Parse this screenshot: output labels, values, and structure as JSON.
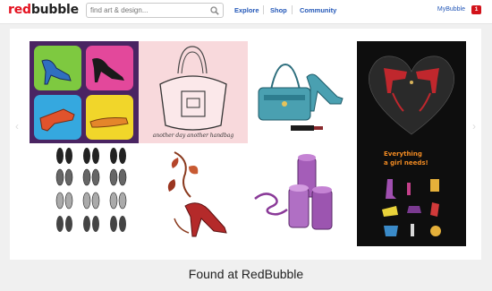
{
  "header": {
    "logo_part1": "red",
    "logo_part2": "bubble",
    "search_placeholder": "find art & design...",
    "nav": [
      "Explore",
      "Shop",
      "Community"
    ],
    "account_label": "MyBubble",
    "notification_count": "1"
  },
  "gallery": {
    "tiles": [
      {
        "name": "shoes-popart",
        "background": "#4a2462"
      },
      {
        "name": "handbag-sketch",
        "background": "#f8d9dc",
        "caption": "another day another handbag"
      },
      {
        "name": "bag-and-heels",
        "background": "#ffffff"
      },
      {
        "name": "heart-heels",
        "background": "#0e0e0e"
      },
      {
        "name": "shoe-grid",
        "background": "#ffffff"
      },
      {
        "name": "floral-heel",
        "background": "#ffffff"
      },
      {
        "name": "lipsticks",
        "background": "#ffffff"
      },
      {
        "name": "girl-needs",
        "background": "#0e0e0e",
        "title_line1": "Everything",
        "title_line2": "a girl needs!"
      }
    ]
  },
  "footer_caption": "Found at RedBubble"
}
